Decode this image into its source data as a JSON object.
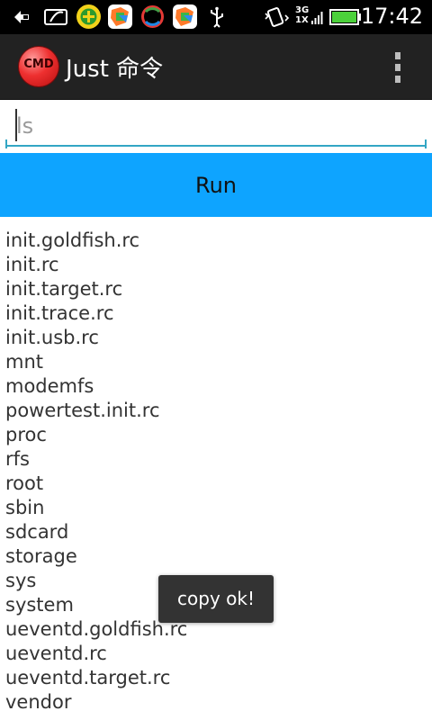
{
  "status_bar": {
    "time": "17:42",
    "network_top": "3G",
    "network_bottom": "1X",
    "icons": [
      "back-arrow-icon",
      "sim-card-icon",
      "green-shield-app-icon",
      "colorful-app-icon",
      "sync-app-icon",
      "colorful-app-icon-2",
      "usb-icon",
      "vibrate-icon",
      "signal-icon",
      "battery-icon"
    ]
  },
  "action_bar": {
    "logo_text": "CMD",
    "title": "Just 命令",
    "overflow_icon": "more-vert-icon",
    "background_color": "#222222"
  },
  "command": {
    "value": "ls",
    "underline_color": "#33a6c4"
  },
  "run_button": {
    "label": "Run",
    "color": "#0ea4ff"
  },
  "output": {
    "items": [
      "init.goldfish.rc",
      "init.rc",
      "init.target.rc",
      "init.trace.rc",
      "init.usb.rc",
      "mnt",
      "modemfs",
      "powertest.init.rc",
      "proc",
      "rfs",
      "root",
      "sbin",
      "sdcard",
      "storage",
      "sys",
      "system",
      "ueventd.goldfish.rc",
      "ueventd.rc",
      "ueventd.target.rc",
      "vendor"
    ]
  },
  "toast": {
    "message": "copy ok!"
  }
}
